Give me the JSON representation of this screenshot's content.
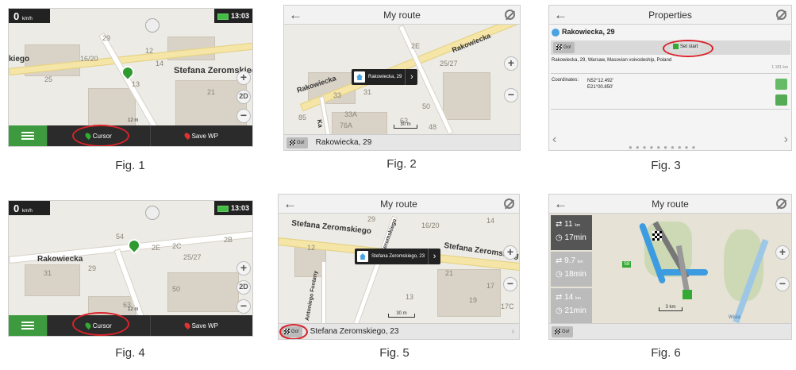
{
  "fig1": {
    "speed": "0",
    "speed_unit": "km/h",
    "time": "13:03",
    "labels": {
      "street": "Stefana Zeromskiego",
      "left": "kiego"
    },
    "numbers": [
      "29",
      "16/20",
      "14",
      "25",
      "12",
      "13",
      "21",
      "12 m"
    ],
    "cursor": "Cursor",
    "save": "Save WP",
    "caption": "Fig. 1",
    "zoom_mode": "2D"
  },
  "fig2": {
    "title": "My route",
    "popup": "Rakowiecka, 29",
    "street1": "Rakowiecka",
    "street2": "Rakowiecka",
    "street3": "Ka",
    "numbers": [
      "2E",
      "25/27",
      "33",
      "31",
      "50",
      "33A",
      "85",
      "76A",
      "63",
      "48",
      "30 m"
    ],
    "go": "Go!",
    "address": "Rakowiecka, 29",
    "caption": "Fig. 2"
  },
  "fig3": {
    "title": "Properties",
    "name": "Rakowiecka, 29",
    "go": "Go!",
    "set_start": "Set start",
    "address": "Rakowiecka, 29, Warsaw, Masovian voivodeship, Poland",
    "distance": "1 181 km",
    "coords_label": "Coordinates:",
    "lat": "N52°12.492'",
    "lon": "E21°00.850'",
    "caption": "Fig. 3"
  },
  "fig4": {
    "speed": "0",
    "speed_unit": "km/h",
    "time": "13:03",
    "street": "Rakowiecka",
    "numbers": [
      "54",
      "2C",
      "2E",
      "2B",
      "25/27",
      "29",
      "31",
      "50",
      "63",
      "12 m"
    ],
    "cursor": "Cursor",
    "save": "Save WP",
    "caption": "Fig. 4",
    "zoom_mode": "2D"
  },
  "fig5": {
    "title": "My route",
    "street1": "Stefana Zeromskiego",
    "street2": "Stefana Zeromskiego",
    "street3": "Antoniego Fontany",
    "street4": "Zeromskiego",
    "popup": "Stefana Zeromskiego, 23",
    "numbers": [
      "29",
      "16/20",
      "14",
      "12",
      "21",
      "13",
      "19",
      "17",
      "17C",
      "30 m"
    ],
    "go": "Go!",
    "address": "Stefana Zeromskiego, 23",
    "caption": "Fig. 5"
  },
  "fig6": {
    "title": "My route",
    "routes": [
      {
        "dist": "11",
        "unit": "km",
        "time": "17min"
      },
      {
        "dist": "9.7",
        "unit": "km",
        "time": "18min"
      },
      {
        "dist": "14",
        "unit": "km",
        "time": "21min"
      }
    ],
    "road": "S8",
    "river": "Wisla",
    "scale": "3 km",
    "go": "Go!",
    "caption": "Fig. 6"
  }
}
